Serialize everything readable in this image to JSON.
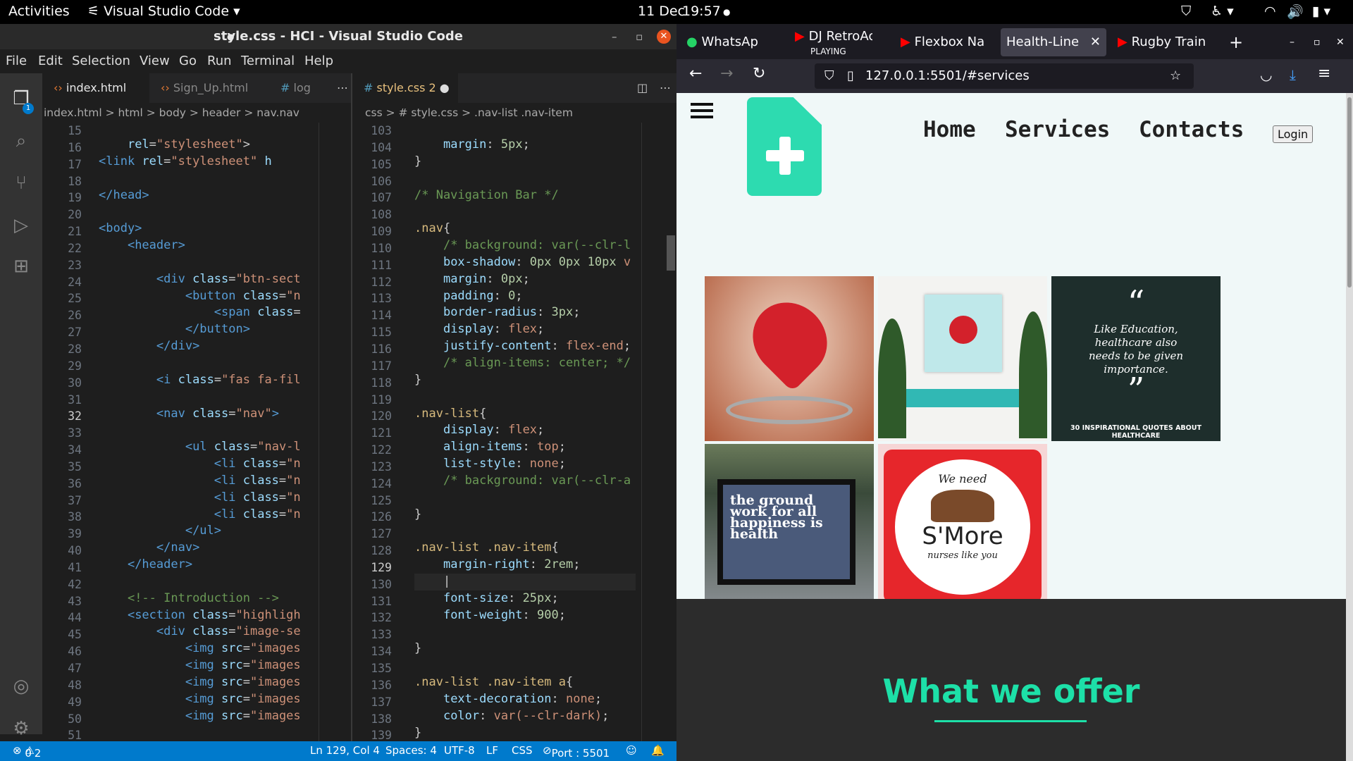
{
  "system": {
    "activities": "Activities",
    "app": "Visual Studio Code",
    "date": "11 Dec",
    "time": "19:57"
  },
  "vscode": {
    "title": "style.css - HCI - Visual Studio Code",
    "menu": [
      "File",
      "Edit",
      "Selection",
      "View",
      "Go",
      "Run",
      "Terminal",
      "Help"
    ],
    "left_tabs": [
      "index.html",
      "Sign_Up.html",
      "log"
    ],
    "right_tab": "style.css",
    "right_tab_badge": "2",
    "left_crumbs": "index.html > html > body > header > nav.nav",
    "right_crumbs": "css > # style.css > .nav-list .nav-item",
    "left_line_numbers": [
      "15",
      "16",
      "17",
      "18",
      "19",
      "20",
      "21",
      "22",
      "23",
      "24",
      "25",
      "26",
      "27",
      "28",
      "29",
      "30",
      "31",
      "32",
      "33",
      "34",
      "35",
      "36",
      "37",
      "38",
      "39",
      "40",
      "41",
      "42",
      "43",
      "44",
      "45",
      "46",
      "47",
      "48",
      "49",
      "50",
      "51"
    ],
    "right_line_numbers": [
      "103",
      "104",
      "105",
      "106",
      "107",
      "108",
      "109",
      "110",
      "111",
      "112",
      "113",
      "114",
      "115",
      "116",
      "117",
      "118",
      "119",
      "120",
      "121",
      "122",
      "123",
      "124",
      "125",
      "126",
      "127",
      "128",
      "129",
      "130",
      "131",
      "132",
      "133",
      "134",
      "135",
      "136",
      "137",
      "138",
      "139"
    ],
    "status": {
      "problems": "0",
      "warnings": "2",
      "position": "Ln 129, Col 4",
      "spaces": "Spaces: 4",
      "encoding": "UTF-8",
      "eol": "LF",
      "lang": "CSS",
      "port": "Port : 5501"
    }
  },
  "firefox": {
    "tabs": [
      "WhatsApp",
      "DJ RetroAc",
      "Flexbox Na",
      "Health-Line",
      "Rugby Train"
    ],
    "tab_sub": "PLAYING",
    "url": "127.0.0.1:5501/#services",
    "nav_links": [
      "Home",
      "Services",
      "Contacts"
    ],
    "login": "Login",
    "quote_text": "Like Education, healthcare also needs to be given importance.",
    "quote_caption": "30 INSPIRATIONAL QUOTES ABOUT HEALTHCARE",
    "poster_text": "the ground work for all happiness is health",
    "smore_top": "We need",
    "smore_mid": "S'More",
    "smore_bottom": "nurses like you",
    "offer_heading": "What we offer"
  }
}
